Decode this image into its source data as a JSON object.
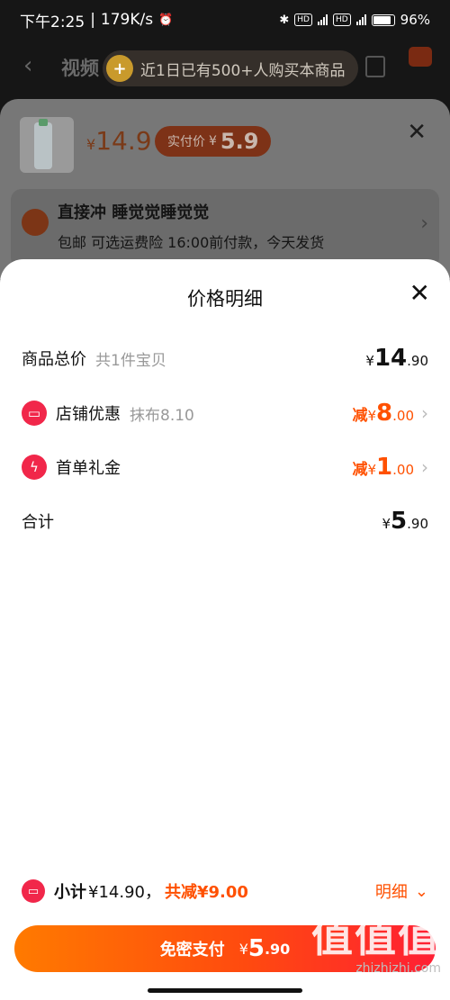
{
  "status_bar": {
    "time": "下午2:25",
    "speed": "179K/s",
    "battery": "96%"
  },
  "background": {
    "nav_tab": "视频",
    "banner_text": "近1日已有500+人购买本商品",
    "banner_icon": "+",
    "price": "14.9",
    "pay_label": "实付价",
    "pay_value": "5.9",
    "address_name": "直接冲 睡觉觉睡觉觉",
    "address_sub": "包邮  可选运费险  16:00前付款，今天发货"
  },
  "sheet": {
    "title": "价格明细",
    "rows": [
      {
        "label": "商品总价",
        "sub": "共1件宝贝",
        "yen": "¥",
        "int": "14",
        "dec": ".90"
      },
      {
        "label": "店铺优惠",
        "sub": "抹布8.10",
        "prefix": "减",
        "yen": "¥",
        "int": "8",
        "dec": ".00"
      },
      {
        "label": "首单礼金",
        "sub": "",
        "prefix": "减",
        "yen": "¥",
        "int": "1",
        "dec": ".00"
      },
      {
        "label": "合计",
        "sub": "",
        "yen": "¥",
        "int": "5",
        "dec": ".90"
      }
    ]
  },
  "summary": {
    "label": "小计",
    "total": "¥14.90，",
    "discount": "共减¥9.00",
    "detail_link": "明细"
  },
  "pay_button": {
    "label": "免密支付",
    "yen": "¥",
    "int": "5",
    "dec": ".90"
  },
  "watermark": {
    "logo": "值值值",
    "text": "zhizhizhi.com"
  },
  "colors": {
    "accent": "#ff5000",
    "coupon_icon": "#f1274a"
  }
}
